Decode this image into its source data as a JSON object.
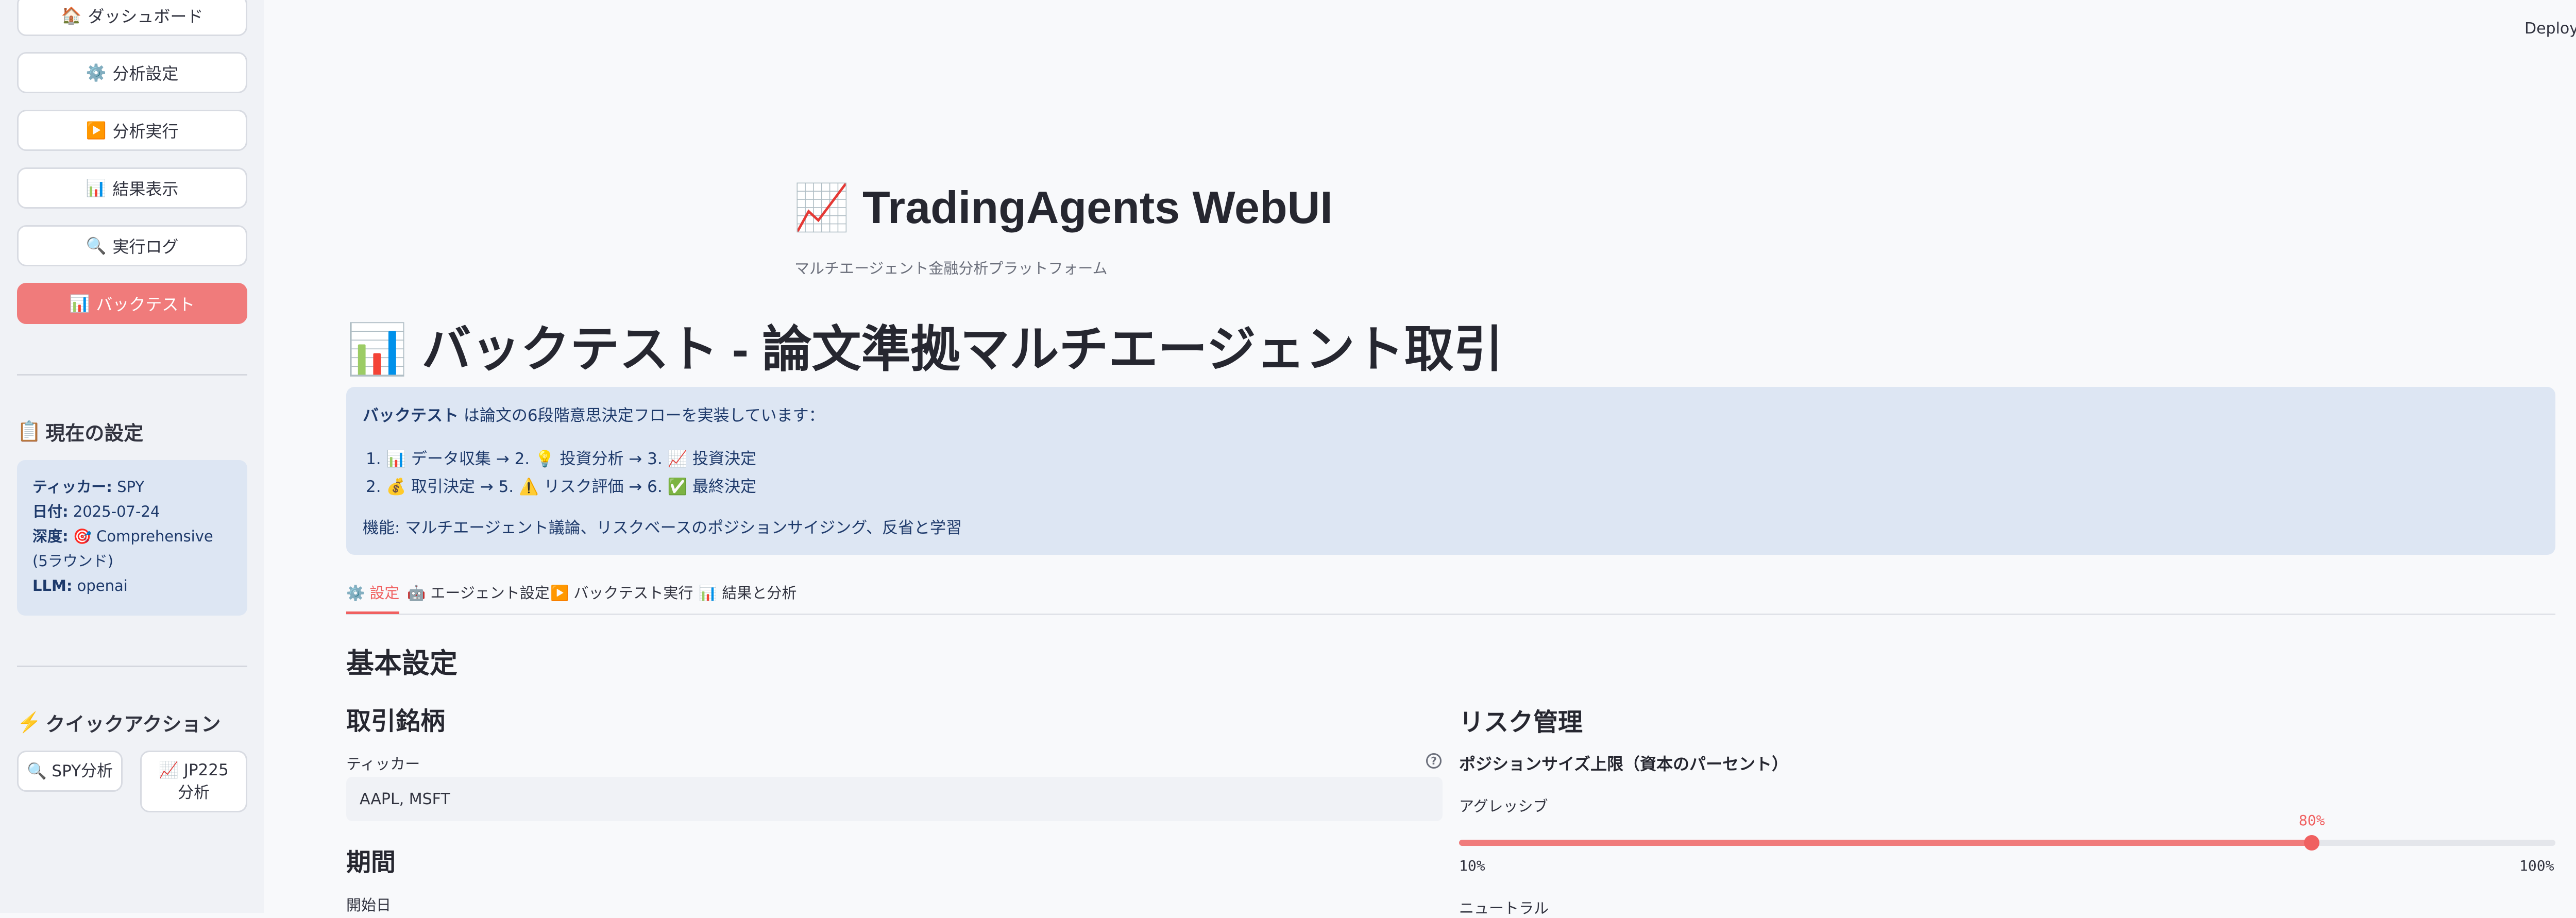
{
  "sidebar": {
    "nav": [
      {
        "icon": "🏠",
        "label": "ダッシュボード"
      },
      {
        "icon": "⚙️",
        "label": "分析設定"
      },
      {
        "icon": "▶️",
        "label": "分析実行"
      },
      {
        "icon": "📊",
        "label": "結果表示"
      },
      {
        "icon": "🔍",
        "label": "実行ログ"
      },
      {
        "icon": "📊",
        "label": "バックテスト"
      }
    ],
    "current_settings": {
      "icon": "📋",
      "title": "現在の設定",
      "ticker_label": "ティッカー:",
      "ticker_value": "SPY",
      "date_label": "日付:",
      "date_value": "2025-07-24",
      "depth_label": "深度:",
      "depth_value": "🎯 Comprehensive (5ラウンド)",
      "llm_label": "LLM:",
      "llm_value": "openai"
    },
    "quick_actions": {
      "icon": "⚡",
      "title": "クイックアクション",
      "spy_label": "🔍 SPY分析",
      "jp_label": "📈 JP225分析"
    }
  },
  "topbar": {
    "deploy_label": "Deploy"
  },
  "header": {
    "app_title": "📈 TradingAgents WebUI",
    "app_subtitle": "マルチエージェント金融分析プラットフォーム"
  },
  "page": {
    "title": "📊 バックテスト - 論文準拠マルチエージェント取引",
    "info": {
      "intro_bold": "バックテスト",
      "intro_rest": " は論文の6段階意思決定フローを実装しています：",
      "step1_num": "1.",
      "step1": "📊 データ収集 → 2. 💡 投資分析 → 3. 📈 投資決定",
      "step2_num": "2.",
      "step2": "💰 取引決定 → 5. ⚠️ リスク評価 → 6. ✅ 最終決定",
      "features": "機能: マルチエージェント議論、リスクベースのポジションサイジング、反省と学習"
    },
    "tabs": [
      {
        "label": "⚙️ 設定"
      },
      {
        "label": "🤖 エージェント設定"
      },
      {
        "label": "▶️ バックテスト実行"
      },
      {
        "label": "📊 結果と分析"
      }
    ],
    "basic_settings": "基本設定",
    "trading_symbols": "取引銘柄",
    "ticker_label": "ティッカー",
    "ticker_value": "AAPL, MSFT",
    "period": "期間",
    "start_date_label": "開始日",
    "risk_mgmt": "リスク管理",
    "position_cap": "ポジションサイズ上限（資本のパーセント）",
    "aggressive_label": "アグレッシブ",
    "aggressive_value": "80%",
    "aggressive_fraction": 0.7778,
    "slider_min": "10%",
    "slider_max": "100%",
    "neutral_label": "ニュートラル"
  },
  "colors": {
    "accent": "#f06060",
    "accent_light": "#f07b7b",
    "info_bg": "#dde6f3",
    "sidebar_bg": "#f0f2f6"
  }
}
